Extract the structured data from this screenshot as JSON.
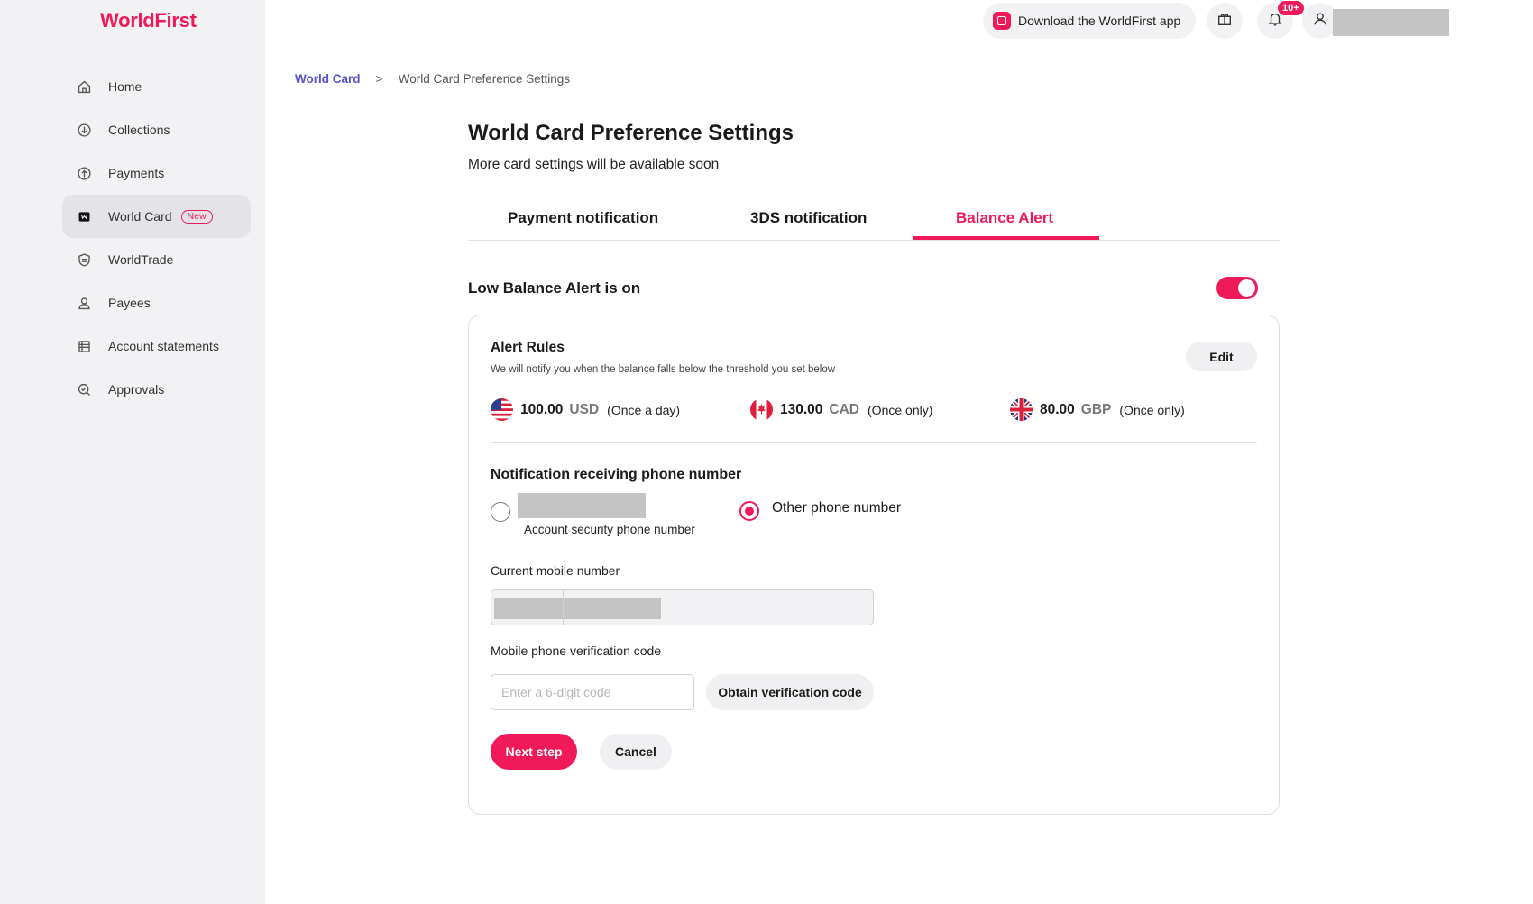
{
  "brand": {
    "name": "WorldFirst",
    "accent": "#f0195a"
  },
  "sidebar": {
    "items": [
      {
        "label": "Home",
        "icon": "home-icon"
      },
      {
        "label": "Collections",
        "icon": "collections-icon"
      },
      {
        "label": "Payments",
        "icon": "payments-icon"
      },
      {
        "label": "World Card",
        "icon": "world-card-icon",
        "badge": "New",
        "active": true
      },
      {
        "label": "WorldTrade",
        "icon": "worldtrade-icon"
      },
      {
        "label": "Payees",
        "icon": "payees-icon"
      },
      {
        "label": "Account statements",
        "icon": "statements-icon"
      },
      {
        "label": "Approvals",
        "icon": "approvals-icon"
      }
    ]
  },
  "header": {
    "download_app_label": "Download the WorldFirst app",
    "notification_count": "10+"
  },
  "breadcrumb": {
    "parent": "World Card",
    "separator": ">",
    "current": "World Card Preference Settings"
  },
  "page": {
    "title": "World Card Preference Settings",
    "subtitle": "More card settings will be available soon"
  },
  "tabs": [
    {
      "label": "Payment notification",
      "active": false
    },
    {
      "label": "3DS notification",
      "active": false
    },
    {
      "label": "Balance Alert",
      "active": true
    }
  ],
  "low_balance": {
    "title": "Low Balance Alert is on",
    "enabled": true
  },
  "alert_rules": {
    "title": "Alert Rules",
    "description": "We will notify you when the balance falls below the threshold you set below",
    "edit_label": "Edit",
    "rules": [
      {
        "amount": "100.00",
        "currency": "USD",
        "frequency": "(Once a day)",
        "flag": "us-flag-icon"
      },
      {
        "amount": "130.00",
        "currency": "CAD",
        "frequency": "(Once only)",
        "flag": "ca-flag-icon"
      },
      {
        "amount": "80.00",
        "currency": "GBP",
        "frequency": "(Once only)",
        "flag": "gb-flag-icon"
      }
    ]
  },
  "phone": {
    "title": "Notification receiving phone number",
    "account_option_sub": "Account security phone number",
    "other_option_label": "Other phone number",
    "selected": "other",
    "current_mobile_label": "Current mobile number",
    "verification_label": "Mobile phone verification code",
    "verification_placeholder": "Enter a 6-digit code",
    "obtain_label": "Obtain verification code"
  },
  "actions": {
    "next_label": "Next step",
    "cancel_label": "Cancel"
  }
}
